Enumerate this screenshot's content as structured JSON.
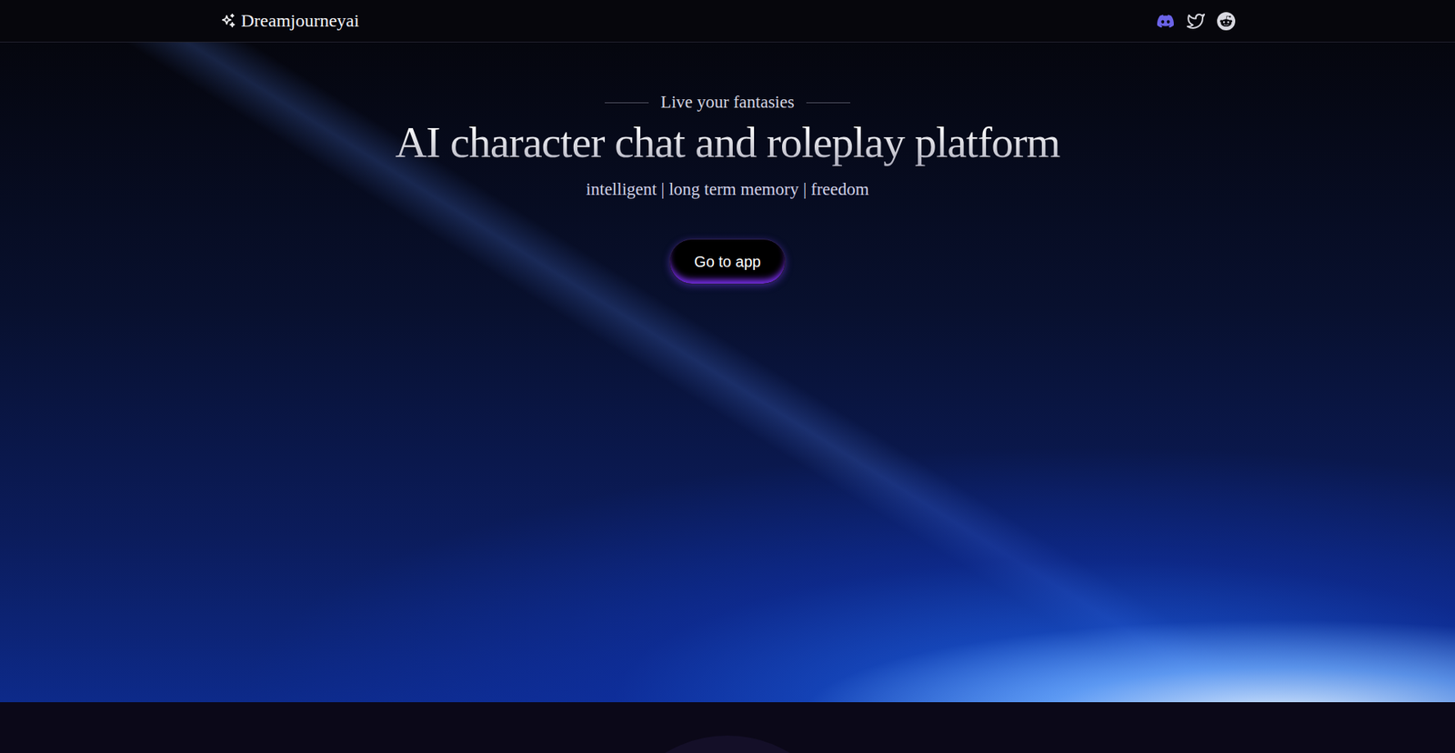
{
  "nav": {
    "brand": "Dreamjourneyai",
    "socials": [
      {
        "kind": "discord"
      },
      {
        "kind": "twitter"
      },
      {
        "kind": "reddit"
      }
    ]
  },
  "hero": {
    "eyebrow": "Live your fantasies",
    "title": "AI character chat and roleplay platform",
    "tagline": "intelligent | long term memory | freedom",
    "cta": "Go to app"
  }
}
